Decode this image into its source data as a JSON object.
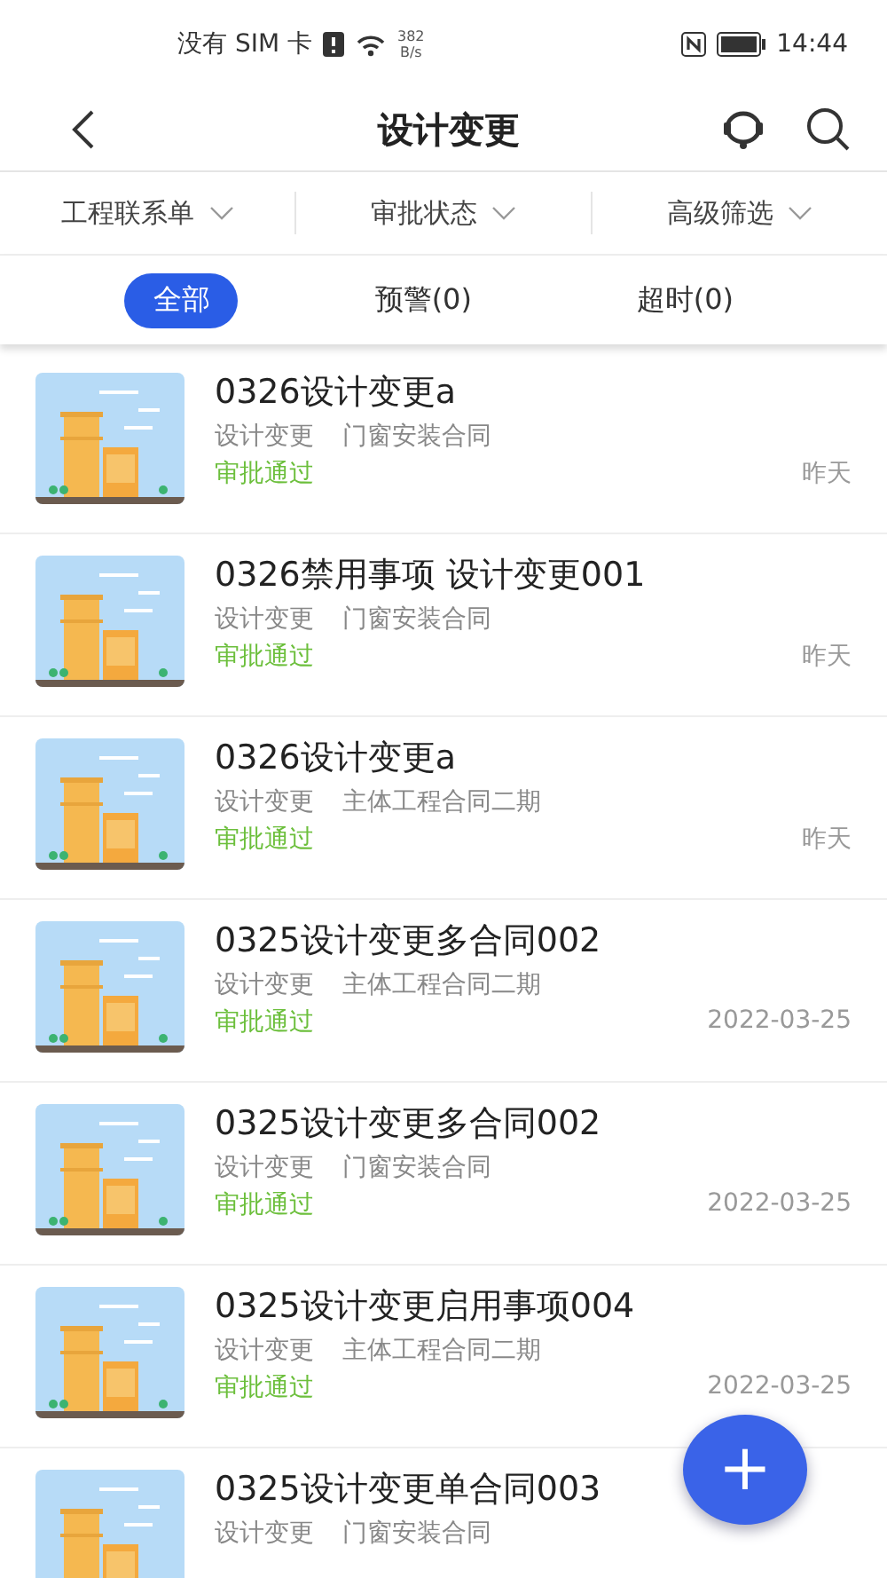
{
  "status_bar": {
    "carrier": "没有 SIM 卡",
    "speed_value": "382",
    "speed_unit": "B/s",
    "time": "14:44"
  },
  "header": {
    "title": "设计变更"
  },
  "filters": [
    {
      "label": "工程联系单"
    },
    {
      "label": "审批状态"
    },
    {
      "label": "高级筛选"
    }
  ],
  "tabs": [
    {
      "label": "全部",
      "selected": true
    },
    {
      "label": "预警(0)",
      "selected": false
    },
    {
      "label": "超时(0)",
      "selected": false
    }
  ],
  "items": [
    {
      "kind": "picture",
      "title": "0326设计变更a",
      "type": "设计变更",
      "contract": "门窗安装合同",
      "status": "审批通过",
      "date": "昨天"
    },
    {
      "kind": "picture",
      "title": "0326禁用事项 设计变更001",
      "type": "设计变更",
      "contract": "门窗安装合同",
      "status": "审批通过",
      "date": "昨天"
    },
    {
      "kind": "picture",
      "title": "0326设计变更a",
      "type": "设计变更",
      "contract": "主体工程合同二期",
      "status": "审批通过",
      "date": "昨天"
    },
    {
      "kind": "picture",
      "title": "0325设计变更多合同002",
      "type": "设计变更",
      "contract": "主体工程合同二期",
      "status": "审批通过",
      "date": "2022-03-25"
    },
    {
      "kind": "picture",
      "title": "0325设计变更多合同002",
      "type": "设计变更",
      "contract": "门窗安装合同",
      "status": "审批通过",
      "date": "2022-03-25"
    },
    {
      "kind": "picture",
      "title": "0325设计变更启用事项004",
      "type": "设计变更",
      "contract": "主体工程合同二期",
      "status": "审批通过",
      "date": "2022-03-25"
    },
    {
      "kind": "picture",
      "title": "0325设计变更单合同003",
      "type": "设计变更",
      "contract": "门窗安装合同"
    }
  ],
  "fab": {
    "label": "+"
  }
}
